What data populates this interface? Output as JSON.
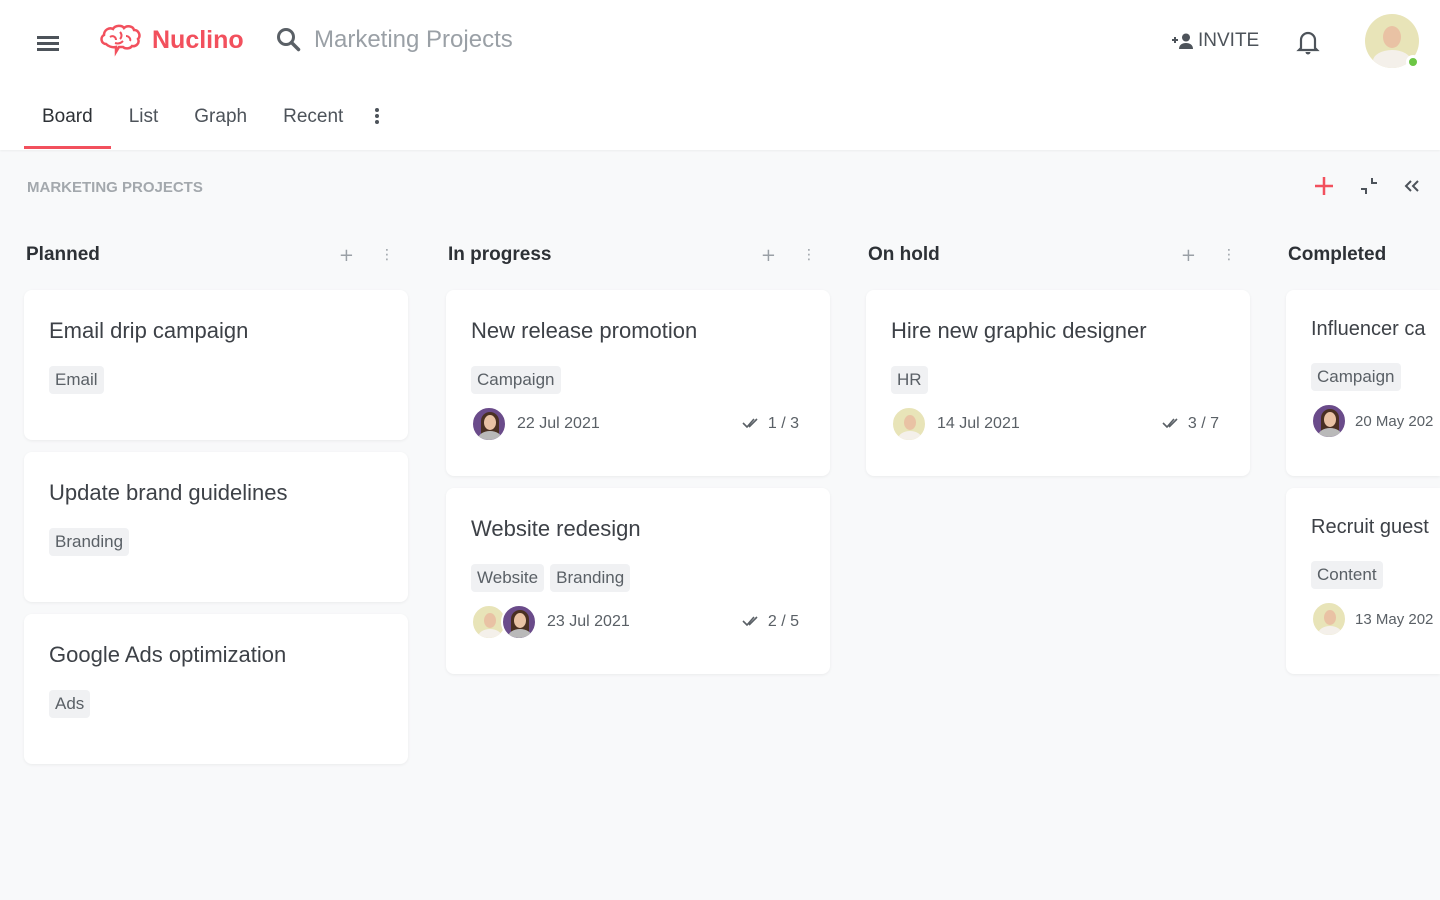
{
  "app": {
    "name": "Nuclino",
    "brand_color": "#f2505d"
  },
  "header": {
    "search_value": "Marketing Projects",
    "invite_label": "INVITE",
    "icons": [
      "menu-icon",
      "brain-logo-icon",
      "search-icon",
      "add-person-icon",
      "bell-icon"
    ],
    "user_status": "online"
  },
  "tabs": [
    {
      "label": "Board",
      "active": true
    },
    {
      "label": "List"
    },
    {
      "label": "Graph"
    },
    {
      "label": "Recent"
    }
  ],
  "breadcrumb": "MARKETING PROJECTS",
  "columns": [
    {
      "title": "Planned",
      "cards": [
        {
          "title": "Email drip campaign",
          "tags": [
            "Email"
          ]
        },
        {
          "title": "Update brand guidelines",
          "tags": [
            "Branding"
          ]
        },
        {
          "title": "Google Ads optimization",
          "tags": [
            "Ads"
          ]
        }
      ]
    },
    {
      "title": "In progress",
      "cards": [
        {
          "title": "New release promotion",
          "tags": [
            "Campaign"
          ],
          "assignees": [
            "w"
          ],
          "date": "22 Jul 2021",
          "tasks": "1 / 3"
        },
        {
          "title": "Website redesign",
          "tags": [
            "Website",
            "Branding"
          ],
          "assignees": [
            "m",
            "w"
          ],
          "date": "23 Jul 2021",
          "tasks": "2 / 5"
        }
      ]
    },
    {
      "title": "On hold",
      "cards": [
        {
          "title": "Hire new graphic designer",
          "tags": [
            "HR"
          ],
          "assignees": [
            "m"
          ],
          "date": "14 Jul 2021",
          "tasks": "3 / 7"
        }
      ]
    },
    {
      "title": "Completed",
      "cards": [
        {
          "title": "Influencer ca",
          "tags": [
            "Campaign"
          ],
          "assignees": [
            "w"
          ],
          "date": "20 May 202"
        },
        {
          "title": "Recruit guest",
          "tags": [
            "Content"
          ],
          "assignees": [
            "m"
          ],
          "date": "13 May 202"
        }
      ]
    }
  ]
}
